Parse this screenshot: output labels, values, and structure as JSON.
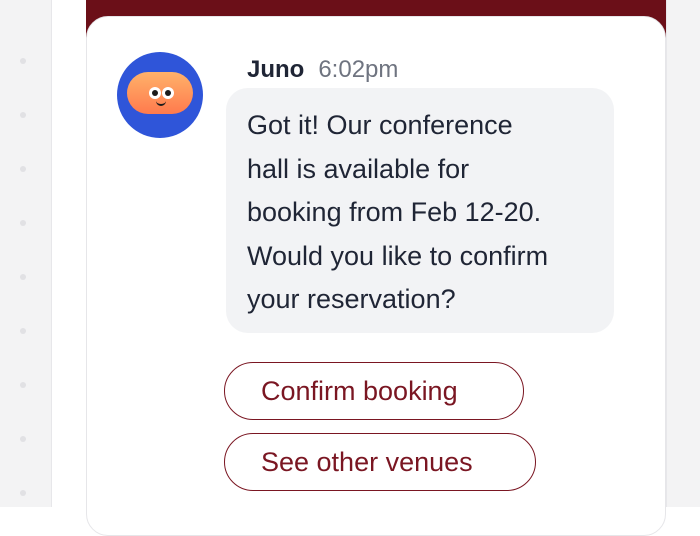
{
  "message": {
    "sender": "Juno",
    "time": "6:02pm",
    "lines": [
      "Got it! Our conference",
      "hall is available for",
      "booking from Feb 12-20.",
      "Would you like to confirm",
      "your reservation?"
    ]
  },
  "quick_replies": [
    {
      "label": "Confirm booking"
    },
    {
      "label": "See other venues"
    }
  ],
  "colors": {
    "accent": "#6b0f18",
    "button_text": "#7a1622",
    "avatar_bg": "#2f55d9",
    "bubble_bg": "#f2f3f5"
  },
  "icons": {
    "avatar": "smiling-blob-avatar"
  }
}
